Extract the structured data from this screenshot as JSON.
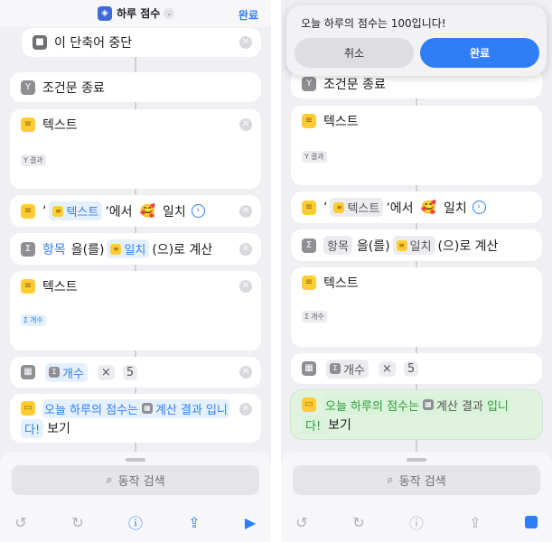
{
  "app": {
    "shortcut_name": "하루 점수",
    "done_label": "완료"
  },
  "actions": {
    "stop": "이 단축어 중단",
    "end_if": "조건문 종료",
    "text1": {
      "title": "텍스트",
      "token": "결과"
    },
    "match": {
      "quote_open": "‘",
      "token": "텍스트",
      "suffix": "’에서",
      "emoji": "🥰",
      "word": "일치"
    },
    "count": {
      "p1": "항목",
      "p2": "을(를)",
      "token": "일치",
      "p3": "(으)로 계산"
    },
    "text2": {
      "title": "텍스트",
      "token": "개수"
    },
    "calc": {
      "token": "개수",
      "op": "×",
      "value": "5"
    },
    "show": {
      "part1": "오늘 하루의 점수는",
      "token": "계산 결과",
      "part2": "입니",
      "part3": "다!",
      "action": "보기"
    }
  },
  "alert": {
    "message": "오늘 하루의 점수는 100입니다!",
    "cancel": "취소",
    "done": "완료"
  },
  "bottom": {
    "search_placeholder": "동작 검색"
  }
}
